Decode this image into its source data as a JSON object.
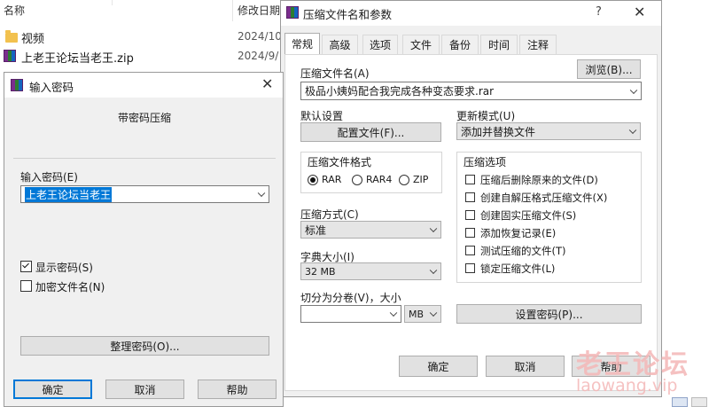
{
  "explorer": {
    "col_name": "名称",
    "col_date": "修改日期",
    "files": [
      {
        "name": "视频",
        "date": "2024/10",
        "icon": "folder-icon"
      },
      {
        "name": "上老王论坛当老王.zip",
        "date": "2024/9/",
        "icon": "archive-icon"
      }
    ]
  },
  "pwd_dialog": {
    "title": "输入密码",
    "subtitle": "带密码压缩",
    "field_label": "输入密码(E)",
    "password_value": "上老王论坛当老王",
    "show_password": "显示密码(S)",
    "encrypt_filenames": "加密文件名(N)",
    "organize_button": "整理密码(O)...",
    "ok": "确定",
    "cancel": "取消",
    "help": "帮助"
  },
  "main_dialog": {
    "title": "压缩文件名和参数",
    "help_glyph": "?",
    "tabs": [
      "常规",
      "高级",
      "选项",
      "文件",
      "备份",
      "时间",
      "注释"
    ],
    "archive_name_label": "压缩文件名(A)",
    "browse": "浏览(B)...",
    "archive_name": "极品小姨妈配合我完成各种变态要求.rar",
    "default_settings": "默认设置",
    "profiles": "配置文件(F)...",
    "update_mode_label": "更新模式(U)",
    "update_mode": "添加并替换文件",
    "format_label": "压缩文件格式",
    "formats": [
      "RAR",
      "RAR4",
      "ZIP"
    ],
    "method_label": "压缩方式(C)",
    "method": "标准",
    "dict_label": "字典大小(I)",
    "dict": "32 MB",
    "split_label": "切分为分卷(V)，大小",
    "split_unit": "MB",
    "options_label": "压缩选项",
    "options": [
      "压缩后删除原来的文件(D)",
      "创建自解压格式压缩文件(X)",
      "创建固实压缩文件(S)",
      "添加恢复记录(E)",
      "测试压缩的文件(T)",
      "锁定压缩文件(L)"
    ],
    "set_password": "设置密码(P)...",
    "ok": "确定",
    "cancel": "取消",
    "help": "帮助"
  },
  "watermark": {
    "line1": "老王论坛",
    "line2": "laowang.vip"
  },
  "colors": {
    "accent": "#0078d7",
    "selection": "#0078d7",
    "watermark": "#f4b7b7"
  }
}
